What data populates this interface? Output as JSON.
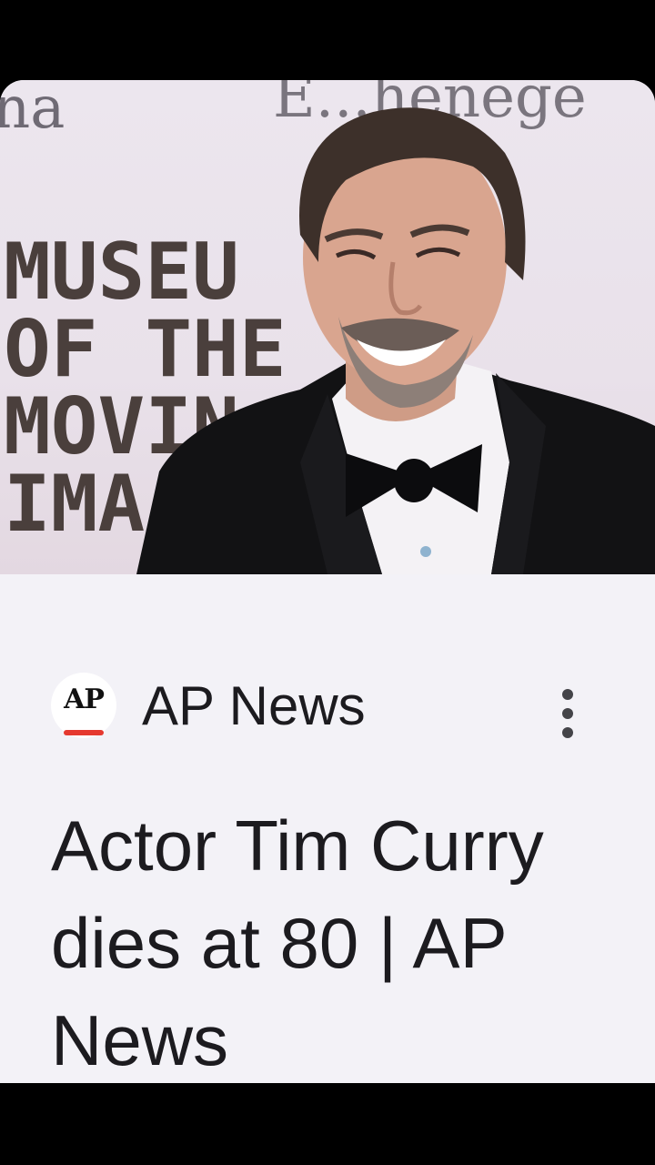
{
  "article_card": {
    "image": {
      "description_icon": "person-photo-icon",
      "backdrop_text_lines": [
        "MUSEU",
        "OF THE",
        "MOVIN",
        "IMA"
      ],
      "backdrop_top_text_left": "na",
      "backdrop_top_text_right": "E...henege"
    },
    "source": {
      "logo_text": "AP",
      "name": "AP News"
    },
    "more_options_icon": "more-vert-icon",
    "headline": "Actor Tim Curry dies at 80 | AP News"
  },
  "colors": {
    "background": "#000000",
    "card": "#f3f2f7",
    "text": "#1c1b1f",
    "ap_accent": "#e5392f"
  }
}
